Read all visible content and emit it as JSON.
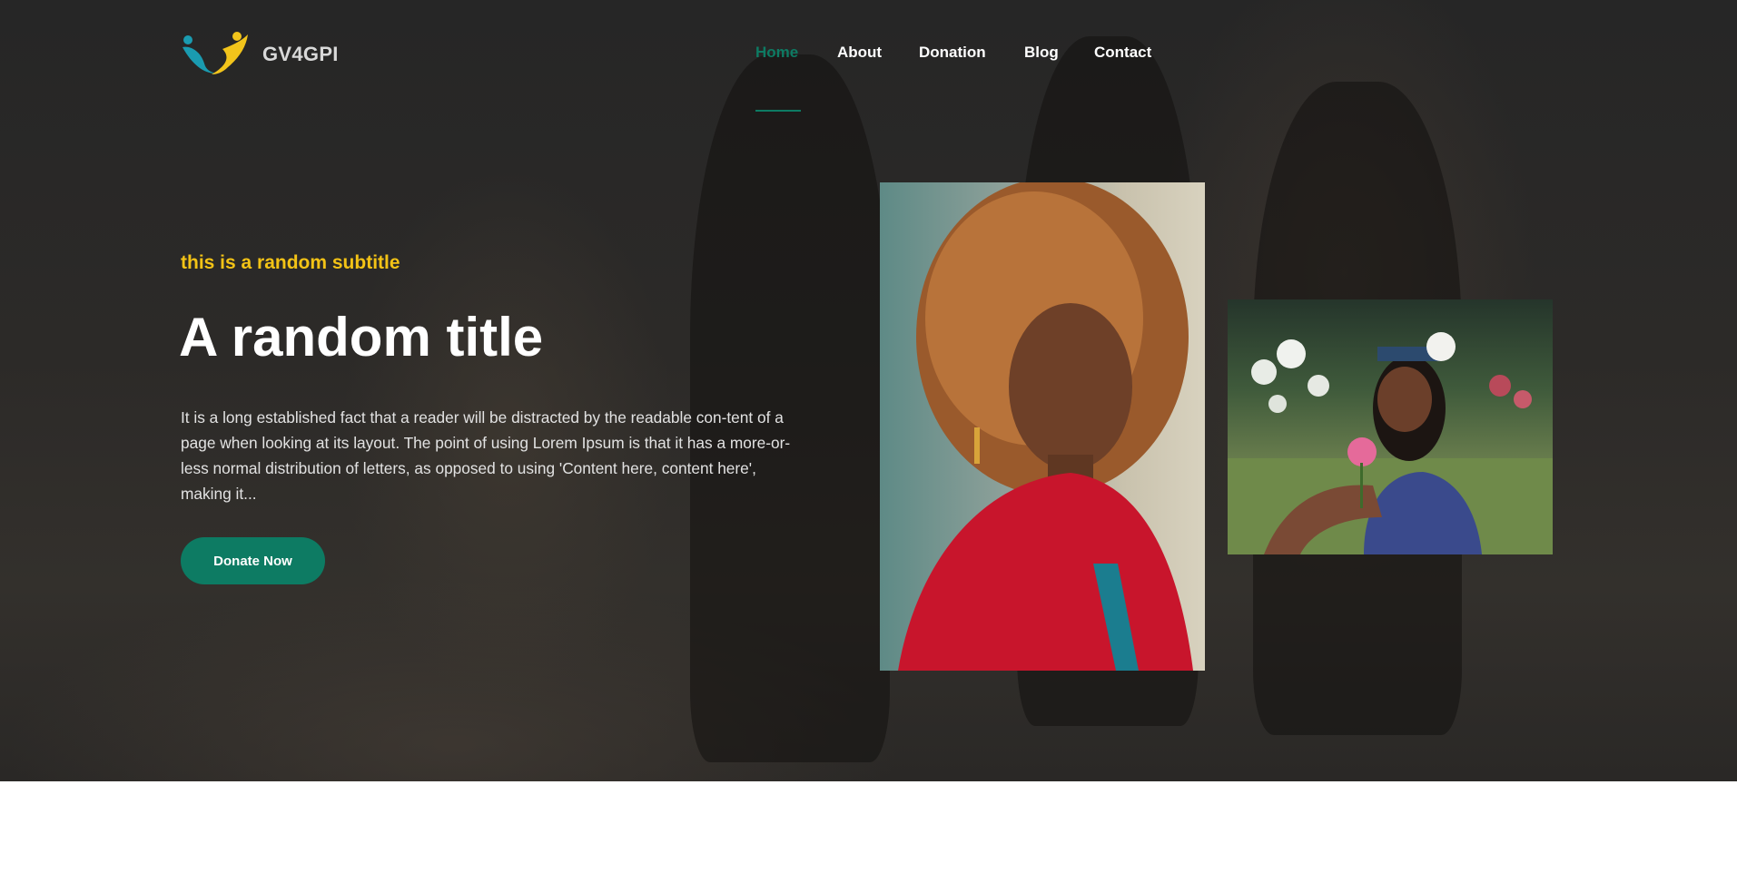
{
  "brand": {
    "name": "GV4GPI"
  },
  "nav": {
    "items": [
      {
        "label": "Home",
        "active": true
      },
      {
        "label": "About",
        "active": false
      },
      {
        "label": "Donation",
        "active": false
      },
      {
        "label": "Blog",
        "active": false
      },
      {
        "label": "Contact",
        "active": false
      }
    ]
  },
  "hero": {
    "subtitle": "this is a random subtitle",
    "title": "A random title",
    "body": "It is a long established fact that a reader will be distracted by the readable con-tent of a page when looking at its layout. The point of using Lorem Ipsum is that it has a more-or-less normal distribution of letters, as opposed to using 'Content here, content here', making it...",
    "cta_label": "Donate Now",
    "images": [
      {
        "icon": "portrait-woman-red-jacket-image"
      },
      {
        "icon": "woman-sitting-with-flower-image"
      }
    ]
  },
  "colors": {
    "accent": "#0d7b63",
    "subtitle": "#f3c316",
    "logo_teal": "#1a9bb0",
    "logo_yellow": "#f2c41b"
  }
}
